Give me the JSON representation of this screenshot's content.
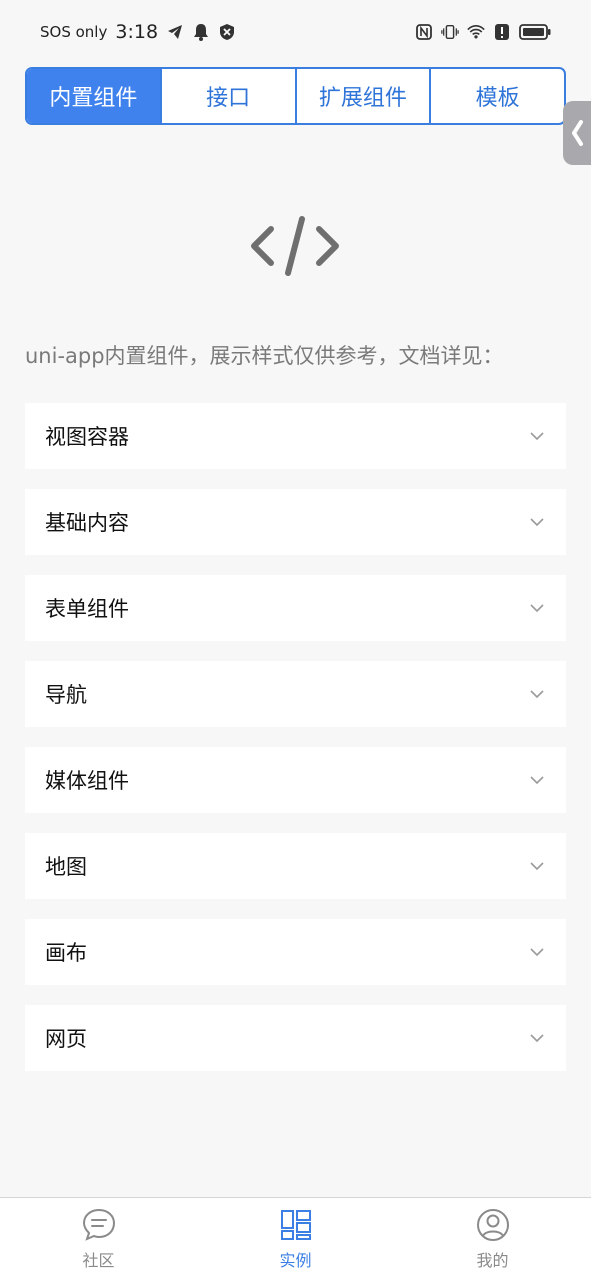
{
  "status_bar": {
    "carrier": "SOS only",
    "time": "3:18",
    "icons": [
      "telegram-icon",
      "bell-icon",
      "vpn-blocked-icon",
      "nfc-icon",
      "vibrate-icon",
      "wifi-icon",
      "alert-icon",
      "battery-icon"
    ]
  },
  "tabs": [
    {
      "label": "内置组件",
      "active": true
    },
    {
      "label": "接口",
      "active": false
    },
    {
      "label": "扩展组件",
      "active": false
    },
    {
      "label": "模板",
      "active": false
    }
  ],
  "intro": "uni-app内置组件，展示样式仅供参考，文档详见：",
  "list": [
    {
      "label": "视图容器"
    },
    {
      "label": "基础内容"
    },
    {
      "label": "表单组件"
    },
    {
      "label": "导航"
    },
    {
      "label": "媒体组件"
    },
    {
      "label": "地图"
    },
    {
      "label": "画布"
    },
    {
      "label": "网页"
    }
  ],
  "bottom_nav": [
    {
      "label": "社区",
      "icon": "chat-icon",
      "active": false
    },
    {
      "label": "实例",
      "icon": "grid-icon",
      "active": true
    },
    {
      "label": "我的",
      "icon": "user-icon",
      "active": false
    }
  ],
  "colors": {
    "accent": "#3f82ee",
    "inactive": "#8a8a8a",
    "background": "#f7f7f7"
  }
}
